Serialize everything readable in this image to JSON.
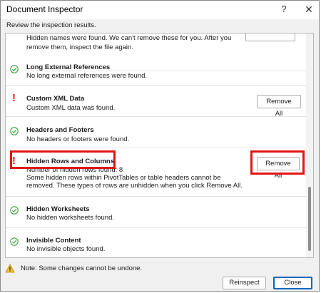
{
  "window": {
    "title": "Document Inspector",
    "help_glyph": "?",
    "close_glyph": "✕"
  },
  "subtitle": "Review the inspection results.",
  "sections": [
    {
      "status": "partial",
      "title": "",
      "lines": [
        "Hidden names were found. We can't remove these for you. After you",
        "remove them, inspect the file again."
      ]
    },
    {
      "status": "ok",
      "title": "Long External References",
      "lines": [
        "No long external references were found."
      ]
    },
    {
      "status": "warning",
      "title": "Custom XML Data",
      "lines": [
        "Custom XML data was found."
      ],
      "button": "Remove All"
    },
    {
      "status": "ok",
      "title": "Headers and Footers",
      "lines": [
        "No headers or footers were found."
      ]
    },
    {
      "status": "warning",
      "title": "Hidden Rows and Columns",
      "lines": [
        "Number of hidden rows found: 8",
        "Some hidden rows within PivotTables or table headers cannot be",
        "removed. These types of rows are unhidden when you click Remove All."
      ],
      "button": "Remove All",
      "highlighted": true
    },
    {
      "status": "ok",
      "title": "Hidden Worksheets",
      "lines": [
        "No hidden worksheets found."
      ]
    },
    {
      "status": "ok",
      "title": "Invisible Content",
      "lines": [
        "No invisible objects found."
      ]
    }
  ],
  "note": "Note: Some changes cannot be undone.",
  "footer": {
    "reinspect_label": "Reinspect",
    "close_label": "Close"
  },
  "colors": {
    "ok": "#3aa03a",
    "warning": "#e01b1b",
    "highlight_box": "#e21414",
    "default_button_border": "#0067c0"
  }
}
